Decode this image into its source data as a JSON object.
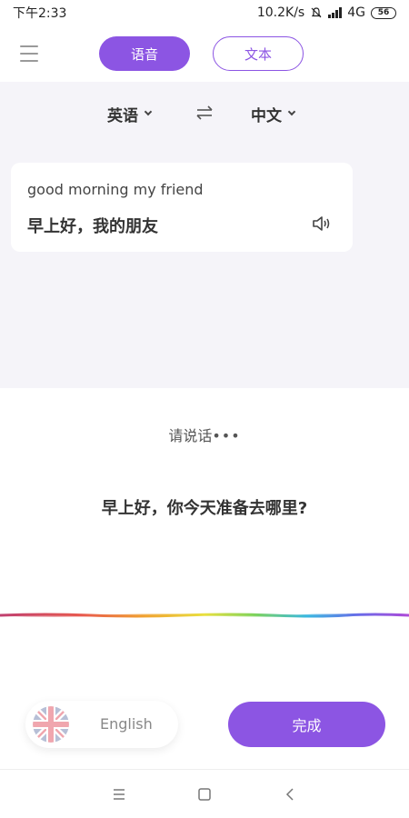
{
  "status_bar": {
    "time": "下午2:33",
    "speed": "10.2K/s",
    "network": "4G",
    "battery": "56"
  },
  "header": {
    "menu_icon": "menu-icon",
    "tabs": [
      {
        "label": "语音",
        "active": true
      },
      {
        "label": "文本",
        "active": false
      }
    ]
  },
  "languages": {
    "source": "英语",
    "target": "中文",
    "swap_icon": "swap-icon"
  },
  "translation_card": {
    "source_text": "good morning my friend",
    "translated_text": "早上好，我的朋友",
    "speaker_icon": "speaker-icon"
  },
  "voice": {
    "prompt": "请说话",
    "prompt_dots": "•••",
    "recognized_text": "早上好，你今天准备去哪里?"
  },
  "bottom": {
    "language_chip_label": "English",
    "flag_icon": "uk-flag-icon",
    "done_label": "完成"
  },
  "nav": [
    "menu-icon",
    "home-icon",
    "back-icon"
  ],
  "colors": {
    "accent": "#8c55e3",
    "panel_background": "#f5f4f9"
  }
}
